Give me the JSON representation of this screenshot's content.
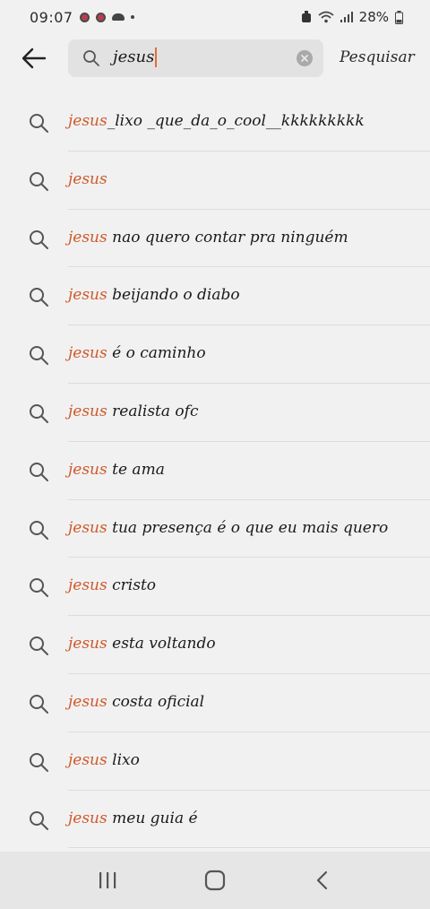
{
  "status_bar": {
    "time": "09:07",
    "battery_text": "28%"
  },
  "search": {
    "query": "jesus",
    "submit_label": "Pesquisar"
  },
  "suggestions": [
    {
      "highlight": "jesus",
      "rest": "_lixo _que_da_o_cool__kkkkkkkkk"
    },
    {
      "highlight": "jesus",
      "rest": ""
    },
    {
      "highlight": "jesus",
      "rest": " nao quero contar pra ninguém"
    },
    {
      "highlight": "jesus",
      "rest": " beijando o diabo"
    },
    {
      "highlight": "jesus",
      "rest": " é o caminho"
    },
    {
      "highlight": "jesus",
      "rest": " realista ofc"
    },
    {
      "highlight": "jesus",
      "rest": " te ama"
    },
    {
      "highlight": "jesus",
      "rest": " tua presença é o que eu mais quero"
    },
    {
      "highlight": "jesus",
      "rest": " cristo"
    },
    {
      "highlight": "jesus",
      "rest": " esta voltando"
    },
    {
      "highlight": "jesus",
      "rest": " costa oficial"
    },
    {
      "highlight": "jesus",
      "rest": " lixo"
    },
    {
      "highlight": "jesus",
      "rest": " meu guia é"
    }
  ],
  "icons": {
    "back": "arrow-left-icon",
    "search": "search-icon",
    "clear": "clear-icon",
    "nav_recent": "recent-apps-icon",
    "nav_home": "home-icon",
    "nav_back": "back-icon"
  },
  "colors": {
    "highlight": "#d0582a",
    "caret": "#e07032"
  }
}
